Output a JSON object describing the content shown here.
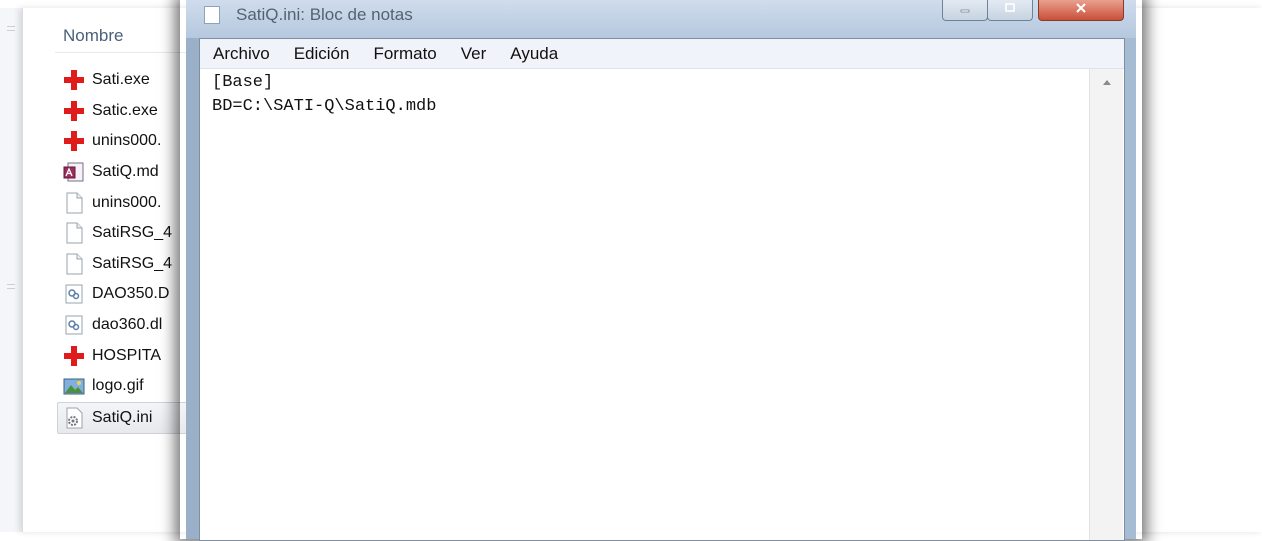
{
  "explorer": {
    "column_header": "Nombre",
    "files": [
      {
        "name": "Sati.exe",
        "icon": "red-cross-icon",
        "selected": false
      },
      {
        "name": "Satic.exe",
        "icon": "red-cross-icon",
        "selected": false
      },
      {
        "name": "unins000.",
        "icon": "red-cross-icon",
        "selected": false
      },
      {
        "name": "SatiQ.md",
        "icon": "access-db-icon",
        "selected": false
      },
      {
        "name": "unins000.",
        "icon": "blank-file-icon",
        "selected": false
      },
      {
        "name": "SatiRSG_4",
        "icon": "blank-file-icon",
        "selected": false
      },
      {
        "name": "SatiRSG_4",
        "icon": "blank-file-icon",
        "selected": false
      },
      {
        "name": "DAO350.D",
        "icon": "dll-icon",
        "selected": false
      },
      {
        "name": "dao360.dl",
        "icon": "dll-icon",
        "selected": false
      },
      {
        "name": "HOSPITA",
        "icon": "red-cross-icon",
        "selected": false
      },
      {
        "name": "logo.gif",
        "icon": "image-icon",
        "selected": false
      },
      {
        "name": "SatiQ.ini",
        "icon": "ini-settings-icon",
        "selected": true
      }
    ]
  },
  "notepad": {
    "title": "SatiQ.ini: Bloc de notas",
    "window_buttons": {
      "minimize": "minimize-icon",
      "maximize": "maximize-icon",
      "close": "close-icon"
    },
    "menu": [
      "Archivo",
      "Edición",
      "Formato",
      "Ver",
      "Ayuda"
    ],
    "content_lines": [
      "[Base]",
      "BD=C:\\SATI-Q\\SatiQ.mdb"
    ],
    "scroll_up_icon": "scroll-up-arrow-icon"
  },
  "colors": {
    "accent_red": "#e01b1b",
    "title_bar": "#c3d3e6",
    "menu_bar": "#f0f3f9"
  }
}
